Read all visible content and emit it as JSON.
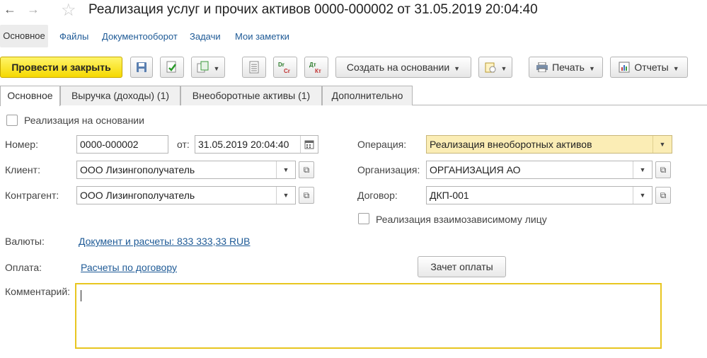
{
  "window": {
    "title": "Реализация услуг и прочих активов 0000-000002 от 31.05.2019 20:04:40",
    "back_icon": "arrow-left-icon",
    "forward_icon": "arrow-right-icon",
    "favorite_icon": "star-icon"
  },
  "subnav": [
    "Основное",
    "Файлы",
    "Документооборот",
    "Задачи",
    "Мои заметки"
  ],
  "toolbar": {
    "post_close": "Провести и закрыть",
    "create_based": "Создать на основании",
    "print": "Печать",
    "reports": "Отчеты",
    "icons": [
      "save-icon",
      "post-icon",
      "copy-icon",
      "list-icon",
      "dt-kt-icon",
      "dt-kt-green-icon",
      "attach-icon",
      "printer-icon",
      "report-icon"
    ]
  },
  "tabs": [
    "Основное",
    "Выручка (доходы) (1)",
    "Внеоборотные активы (1)",
    "Дополнительно"
  ],
  "form": {
    "based_on_label": "Реализация на основании",
    "number_label": "Номер:",
    "number_value": "0000-000002",
    "date_label": "от:",
    "date_value": "31.05.2019 20:04:40",
    "client_label": "Клиент:",
    "client_value": "ООО Лизингополучатель",
    "counterparty_label": "Контрагент:",
    "counterparty_value": "ООО Лизингополучатель",
    "operation_label": "Операция:",
    "operation_value": "Реализация внеоборотных активов",
    "organization_label": "Организация:",
    "organization_value": "ОРГАНИЗАЦИЯ АО",
    "contract_label": "Договор:",
    "contract_value": "ДКП-001",
    "related_party_label": "Реализация взаимозависимому лицу",
    "currency_label": "Валюты:",
    "currency_link": "Документ и расчеты: 833 333,33 RUB",
    "payment_label": "Оплата:",
    "payment_link": "Расчеты по договору",
    "offset_button": "Зачет оплаты",
    "comment_label": "Комментарий:",
    "comment_value": ""
  },
  "colors": {
    "primary_button": "#f5d800",
    "operation_field": "#fbedb5",
    "link": "#1e5a96",
    "comment_border": "#e8c620"
  }
}
